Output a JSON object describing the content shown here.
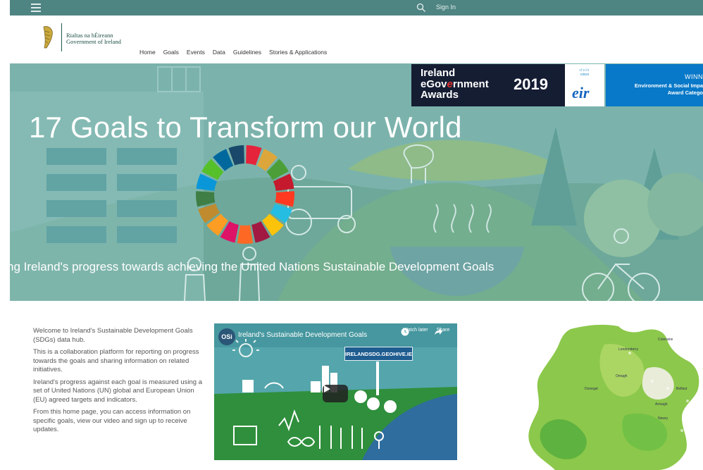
{
  "topbar": {
    "menu_icon": "hamburger-icon",
    "search_icon": "search-icon",
    "signin_label": "Sign In"
  },
  "logo": {
    "line1": "Rialtas na hÉireann",
    "line2": "Government of Ireland",
    "icon": "harp-icon"
  },
  "nav": [
    "Home",
    "Goals",
    "Events",
    "Data",
    "Guidelines",
    "Stories & Applications"
  ],
  "hero": {
    "title": "17 Goals to Transform our World",
    "subtitle": "ng Ireland's progress towards achieving the United Nations Sustainable Development Goals",
    "award_name_l1": "Ireland",
    "award_name_l2": "eGov",
    "award_name_e": "e",
    "award_name_l2b": "rnment",
    "award_name_l3": "Awards",
    "award_year": "2019",
    "sponsor1": "cisco",
    "sponsor2": "eir",
    "winner_label": "WINN",
    "winner_cat1": "Environment & Social Impa",
    "winner_cat2": "Award Catego",
    "wheel_colors": [
      "#e5243b",
      "#dda63a",
      "#4c9f38",
      "#c5192d",
      "#ff3a21",
      "#26bde2",
      "#fcc30b",
      "#a21942",
      "#fd6925",
      "#dd1367",
      "#fd9d24",
      "#bf8b2e",
      "#3f7e44",
      "#0a97d9",
      "#56c02b",
      "#00689d",
      "#19486a"
    ]
  },
  "intro": {
    "p1": "Welcome to Ireland's Sustainable Development Goals (SDGs) data hub.",
    "p2": "This is a collaboration platform for reporting on progress towards the goals and sharing information on related initiatives.",
    "p3": "Ireland's progress against each goal is measured using a set of United Nations (UN) global and European Union (EU) agreed targets and indicators.",
    "p4": "From this home page, you can access information on specific goals, view our video and sign up to receive updates."
  },
  "video": {
    "channel_logo": "OSi",
    "title": "Ireland's Sustainable Development Goals",
    "watch_later": "Watch later",
    "share": "Share",
    "sign_text": "IRELANDSDG.GEOHIVE.IE"
  },
  "colors": {
    "topbar": "#4e8482",
    "hero": "#7bb3ac",
    "award_dark": "#151d33",
    "award_blue": "#0878c8"
  }
}
